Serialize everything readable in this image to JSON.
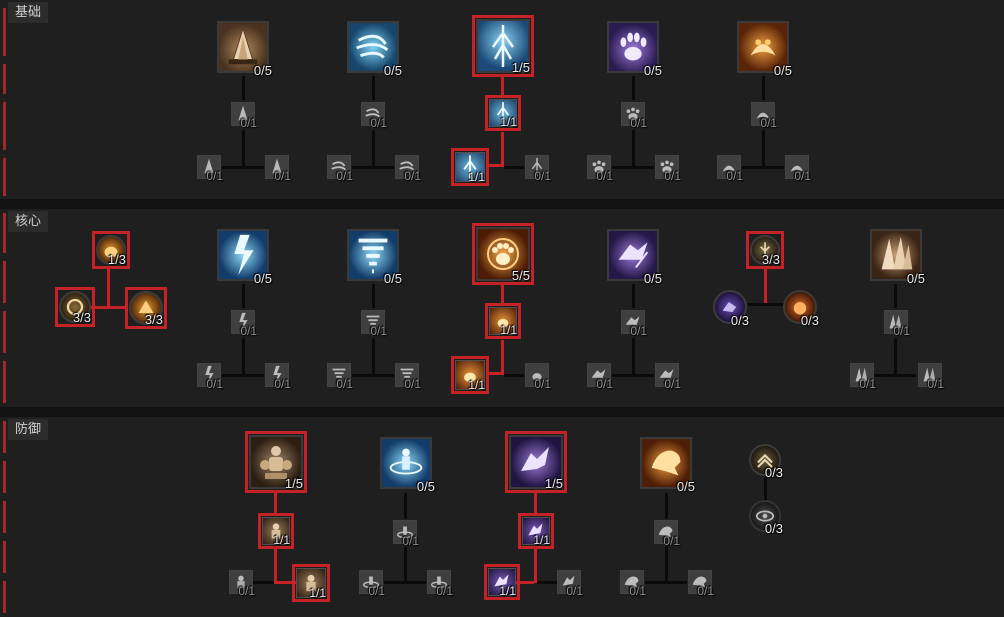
{
  "sections": [
    {
      "title": "基础"
    },
    {
      "title": "核心"
    },
    {
      "title": "防御"
    }
  ],
  "colors": {
    "accent_red": "#c42227",
    "panel_bg": "#1f1f1f",
    "page_bg": "#121212"
  },
  "basic": {
    "b1": {
      "rank": "0/5",
      "icon": "earth-spike-icon"
    },
    "b1u": {
      "rank": "0/1",
      "icon": "earth-spike-upgrade-icon"
    },
    "b1l": {
      "rank": "0/1",
      "icon": "earth-spike-branch-icon"
    },
    "b1r": {
      "rank": "0/1",
      "icon": "earth-spike-branch-icon"
    },
    "b2": {
      "rank": "0/5",
      "icon": "wind-shear-icon"
    },
    "b2u": {
      "rank": "0/1",
      "icon": "wind-shear-upgrade-icon"
    },
    "b2l": {
      "rank": "0/1",
      "icon": "wind-shear-branch-icon"
    },
    "b2r": {
      "rank": "0/1",
      "icon": "wind-shear-branch-icon"
    },
    "b3": {
      "rank": "1/5",
      "icon": "storm-strike-icon"
    },
    "b3u": {
      "rank": "1/1",
      "icon": "storm-strike-upgrade-icon"
    },
    "b3l": {
      "rank": "1/1",
      "icon": "storm-strike-branch-icon"
    },
    "b3r": {
      "rank": "0/1",
      "icon": "storm-strike-branch-icon"
    },
    "b4": {
      "rank": "0/5",
      "icon": "claw-icon"
    },
    "b4u": {
      "rank": "0/1",
      "icon": "claw-upgrade-icon"
    },
    "b4l": {
      "rank": "0/1",
      "icon": "claw-branch-icon"
    },
    "b4r": {
      "rank": "0/1",
      "icon": "claw-branch-icon"
    },
    "b5": {
      "rank": "0/5",
      "icon": "maul-icon"
    },
    "b5u": {
      "rank": "0/1",
      "icon": "maul-upgrade-icon"
    },
    "b5l": {
      "rank": "0/1",
      "icon": "maul-branch-icon"
    },
    "b5r": {
      "rank": "0/1",
      "icon": "maul-branch-icon"
    }
  },
  "core": {
    "p1": {
      "rank": "1/3",
      "icon": "bear-passive-icon"
    },
    "p2": {
      "rank": "3/3",
      "icon": "passive-ring-icon"
    },
    "p3": {
      "rank": "3/3",
      "icon": "passive-wolf-icon"
    },
    "c1": {
      "rank": "0/5",
      "icon": "lightning-storm-icon"
    },
    "c1u": {
      "rank": "0/1",
      "icon": "lightning-storm-upgrade-icon"
    },
    "c1l": {
      "rank": "0/1",
      "icon": "lightning-storm-branch-icon"
    },
    "c1r": {
      "rank": "0/1",
      "icon": "lightning-storm-branch-icon"
    },
    "c2": {
      "rank": "0/5",
      "icon": "tornado-icon"
    },
    "c2u": {
      "rank": "0/1",
      "icon": "tornado-upgrade-icon"
    },
    "c2l": {
      "rank": "0/1",
      "icon": "tornado-branch-icon"
    },
    "c2r": {
      "rank": "0/1",
      "icon": "tornado-branch-icon"
    },
    "c3": {
      "rank": "5/5",
      "icon": "pulverize-icon"
    },
    "c3u": {
      "rank": "1/1",
      "icon": "pulverize-upgrade-icon"
    },
    "c3l": {
      "rank": "1/1",
      "icon": "pulverize-branch-icon"
    },
    "c3r": {
      "rank": "0/1",
      "icon": "pulverize-branch-icon"
    },
    "c4": {
      "rank": "0/5",
      "icon": "shred-icon"
    },
    "c4u": {
      "rank": "0/1",
      "icon": "shred-upgrade-icon"
    },
    "c4l": {
      "rank": "0/1",
      "icon": "shred-branch-icon"
    },
    "c4r": {
      "rank": "0/1",
      "icon": "shred-branch-icon"
    },
    "q1": {
      "rank": "3/3",
      "icon": "passive-ember-icon"
    },
    "q2": {
      "rank": "0/3",
      "icon": "passive-shadow-wolf-icon"
    },
    "q3": {
      "rank": "0/3",
      "icon": "passive-fire-bear-icon"
    },
    "c5": {
      "rank": "0/5",
      "icon": "landslide-icon"
    },
    "c5u": {
      "rank": "0/1",
      "icon": "landslide-upgrade-icon"
    },
    "c5l": {
      "rank": "0/1",
      "icon": "landslide-branch-icon"
    },
    "c5r": {
      "rank": "0/1",
      "icon": "landslide-branch-icon"
    }
  },
  "defense": {
    "d1": {
      "rank": "1/5",
      "icon": "earthen-bulwark-icon"
    },
    "d1u": {
      "rank": "1/1",
      "icon": "earthen-bulwark-upgrade-icon"
    },
    "d1l": {
      "rank": "0/1",
      "icon": "earthen-bulwark-branch-icon"
    },
    "d1r": {
      "rank": "1/1",
      "icon": "earthen-bulwark-branch-icon"
    },
    "d2": {
      "rank": "0/5",
      "icon": "cyclone-armor-icon"
    },
    "d2u": {
      "rank": "0/1",
      "icon": "cyclone-armor-upgrade-icon"
    },
    "d2l": {
      "rank": "0/1",
      "icon": "cyclone-armor-branch-icon"
    },
    "d2r": {
      "rank": "0/1",
      "icon": "cyclone-armor-branch-icon"
    },
    "d3": {
      "rank": "1/5",
      "icon": "blood-howl-icon"
    },
    "d3u": {
      "rank": "1/1",
      "icon": "blood-howl-upgrade-icon"
    },
    "d3l": {
      "rank": "1/1",
      "icon": "blood-howl-branch-icon"
    },
    "d3r": {
      "rank": "0/1",
      "icon": "blood-howl-branch-icon"
    },
    "d4": {
      "rank": "0/5",
      "icon": "debilitating-roar-icon"
    },
    "d4u": {
      "rank": "0/1",
      "icon": "debilitating-roar-upgrade-icon"
    },
    "d4l": {
      "rank": "0/1",
      "icon": "debilitating-roar-branch-icon"
    },
    "d4r": {
      "rank": "0/1",
      "icon": "debilitating-roar-branch-icon"
    },
    "dp1": {
      "rank": "0/3",
      "icon": "passive-chevron-icon"
    },
    "dp2": {
      "rank": "0/3",
      "icon": "passive-eye-icon"
    }
  }
}
